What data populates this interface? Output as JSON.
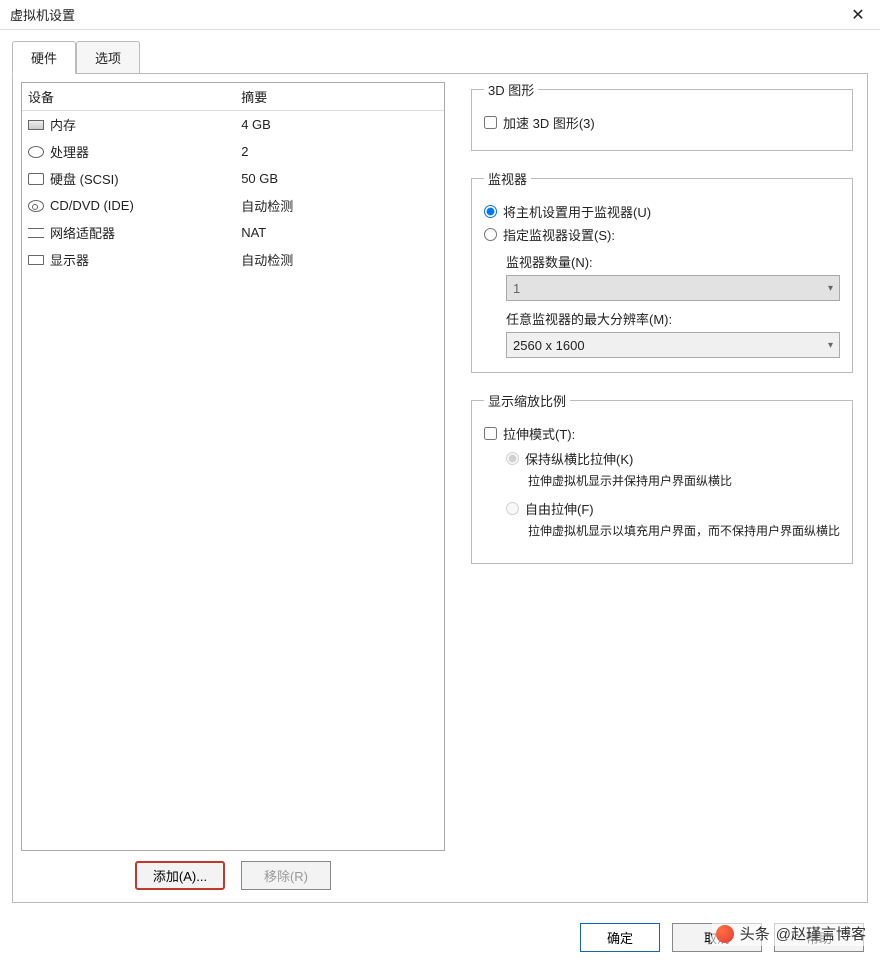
{
  "window": {
    "title": "虚拟机设置",
    "close_glyph": "✕"
  },
  "tabs": {
    "hardware": "硬件",
    "options": "选项"
  },
  "hw_header": {
    "device": "设备",
    "summary": "摘要"
  },
  "hw_rows": [
    {
      "icon": "ico-mem",
      "name": "内存",
      "summary": "4 GB"
    },
    {
      "icon": "ico-cpu",
      "name": "处理器",
      "summary": "2"
    },
    {
      "icon": "ico-disk",
      "name": "硬盘 (SCSI)",
      "summary": "50 GB"
    },
    {
      "icon": "ico-cd",
      "name": "CD/DVD (IDE)",
      "summary": "自动检测"
    },
    {
      "icon": "ico-net",
      "name": "网络适配器",
      "summary": "NAT"
    },
    {
      "icon": "ico-disp",
      "name": "显示器",
      "summary": "自动检测"
    }
  ],
  "left_buttons": {
    "add": "添加(A)...",
    "remove": "移除(R)"
  },
  "right": {
    "g3d": {
      "legend": "3D 图形",
      "accel": "加速 3D 图形(3)"
    },
    "monitors": {
      "legend": "监视器",
      "use_host": "将主机设置用于监视器(U)",
      "specify": "指定监视器设置(S):",
      "count_label": "监视器数量(N):",
      "count_value": "1",
      "maxres_label": "任意监视器的最大分辨率(M):",
      "maxres_value": "2560 x 1600"
    },
    "scaling": {
      "legend": "显示缩放比例",
      "stretch_mode": "拉伸模式(T):",
      "keep_ratio": "保持纵横比拉伸(K)",
      "keep_ratio_desc": "拉伸虚拟机显示并保持用户界面纵横比",
      "free_stretch": "自由拉伸(F)",
      "free_stretch_desc": "拉伸虚拟机显示以填充用户界面，而不保持用户界面纵横比"
    }
  },
  "footer": {
    "ok": "确定",
    "cancel": "取消",
    "help": "帮助"
  },
  "watermark": {
    "prefix": "头条",
    "author": "@赵瑾言博客"
  }
}
